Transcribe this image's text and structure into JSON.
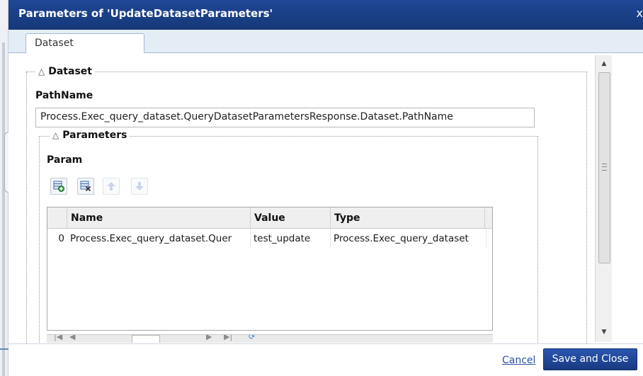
{
  "dialog": {
    "title": "Parameters of 'UpdateDatasetParameters'",
    "close_label": "x"
  },
  "tabs": [
    {
      "label": "Dataset",
      "active": true
    }
  ],
  "dataset_section": {
    "legend": "Dataset",
    "collapse_glyph": "△",
    "pathname_label": "PathName",
    "pathname_value": "Process.Exec_query_dataset.QueryDatasetParametersResponse.Dataset.PathName"
  },
  "parameters_section": {
    "legend": "Parameters",
    "collapse_glyph": "△",
    "param_label": "Param",
    "toolbar": [
      {
        "icon": "add-row-icon",
        "enabled": true
      },
      {
        "icon": "delete-row-icon",
        "enabled": true
      },
      {
        "icon": "move-up-icon",
        "enabled": false
      },
      {
        "icon": "move-down-icon",
        "enabled": false
      }
    ],
    "grid": {
      "columns": [
        "Name",
        "Value",
        "Type"
      ],
      "rows": [
        {
          "index": "0",
          "name": "Process.Exec_query_dataset.Quer",
          "value": "test_update",
          "type": "Process.Exec_query_dataset"
        }
      ]
    }
  },
  "footer": {
    "cancel_label": "Cancel",
    "save_label": "Save and Close"
  },
  "colors": {
    "title_bar": "#1a3e8c",
    "save_button": "#1c3f8a",
    "link": "#2a4fa8"
  }
}
